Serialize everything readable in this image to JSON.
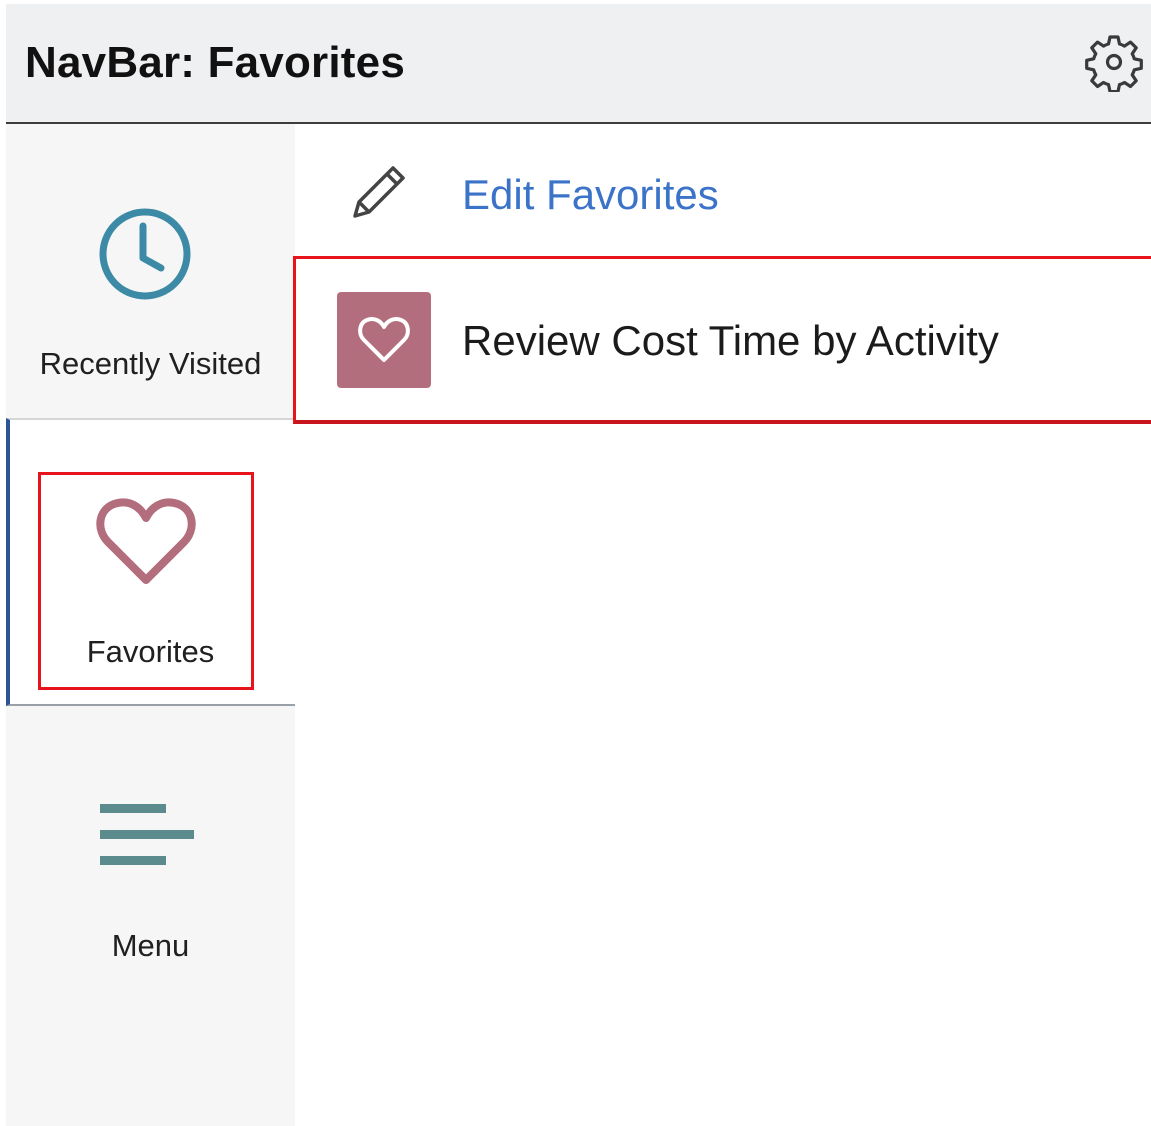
{
  "header": {
    "title": "NavBar: Favorites",
    "settings_icon": "gear-icon"
  },
  "sidebar": {
    "items": [
      {
        "label": "Recently Visited",
        "icon": "clock-icon",
        "color": "#3c8aa6",
        "selected": false
      },
      {
        "label": "Favorites",
        "icon": "heart-icon",
        "color": "#b36e7e",
        "selected": true
      },
      {
        "label": "Menu",
        "icon": "menu-lines-icon",
        "color": "#5b8b8c",
        "selected": false
      }
    ]
  },
  "content": {
    "edit": {
      "icon": "pencil-icon",
      "label": "Edit Favorites",
      "color": "#3b73c9"
    },
    "favorites": [
      {
        "title": "Review Cost Time by Activity",
        "icon": "heart-icon",
        "tile_color": "#b36e7e"
      }
    ]
  },
  "highlight_color": "#e8141c"
}
